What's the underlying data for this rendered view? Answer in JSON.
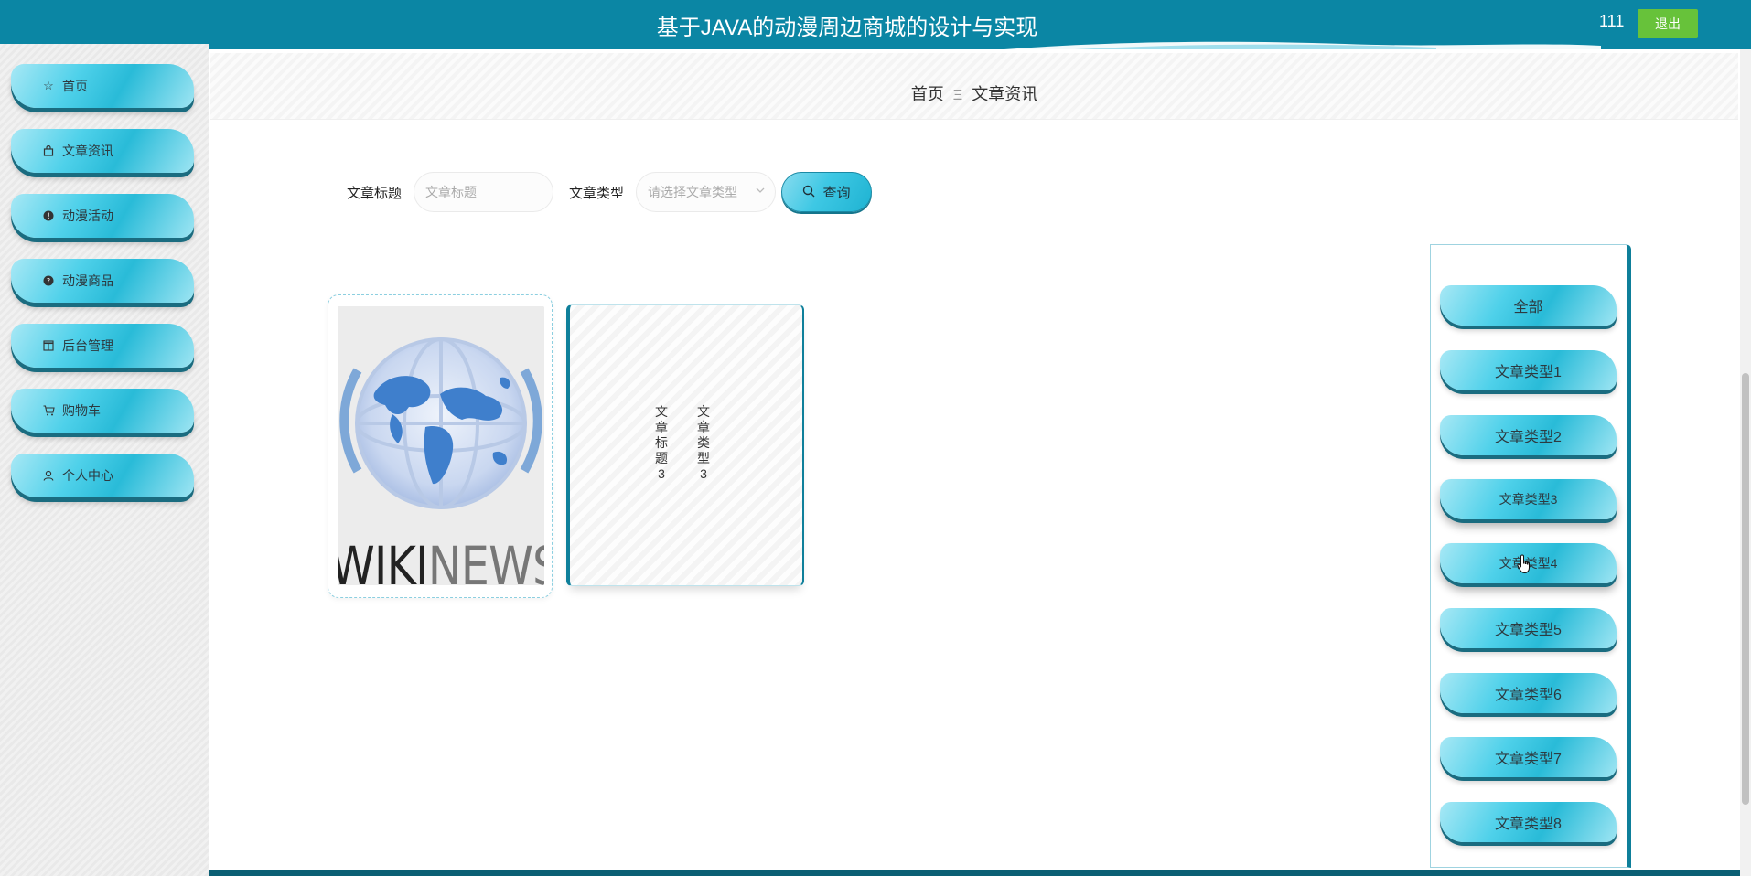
{
  "header": {
    "title": "基于JAVA的动漫周边商城的设计与实现",
    "username": "111",
    "logout_label": "退出",
    "accent_color": "#0b86a4"
  },
  "sidebar": {
    "items": [
      {
        "label": "首页",
        "icon": "star-icon"
      },
      {
        "label": "文章资讯",
        "icon": "bag-icon"
      },
      {
        "label": "动漫活动",
        "icon": "alert-circle-icon"
      },
      {
        "label": "动漫商品",
        "icon": "question-circle-icon"
      },
      {
        "label": "后台管理",
        "icon": "box-icon"
      },
      {
        "label": "购物车",
        "icon": "cart-icon"
      },
      {
        "label": "个人中心",
        "icon": "user-icon"
      }
    ]
  },
  "breadcrumb": {
    "home": "首页",
    "separator": "Ξ",
    "current": "文章资讯"
  },
  "search": {
    "title_label": "文章标题",
    "title_placeholder": "文章标题",
    "type_label": "文章类型",
    "type_placeholder": "请选择文章类型",
    "button_label": "查询"
  },
  "cards": [
    {
      "image": "wikinews-logo",
      "brand_wiki": "WIKI",
      "brand_news": "NEWS"
    },
    {
      "title": "文章标题3",
      "type": "文章类型3"
    }
  ],
  "categories": [
    "全部",
    "文章类型1",
    "文章类型2",
    "文章类型3",
    "文章类型4",
    "文章类型5",
    "文章类型6",
    "文章类型7",
    "文章类型8"
  ]
}
